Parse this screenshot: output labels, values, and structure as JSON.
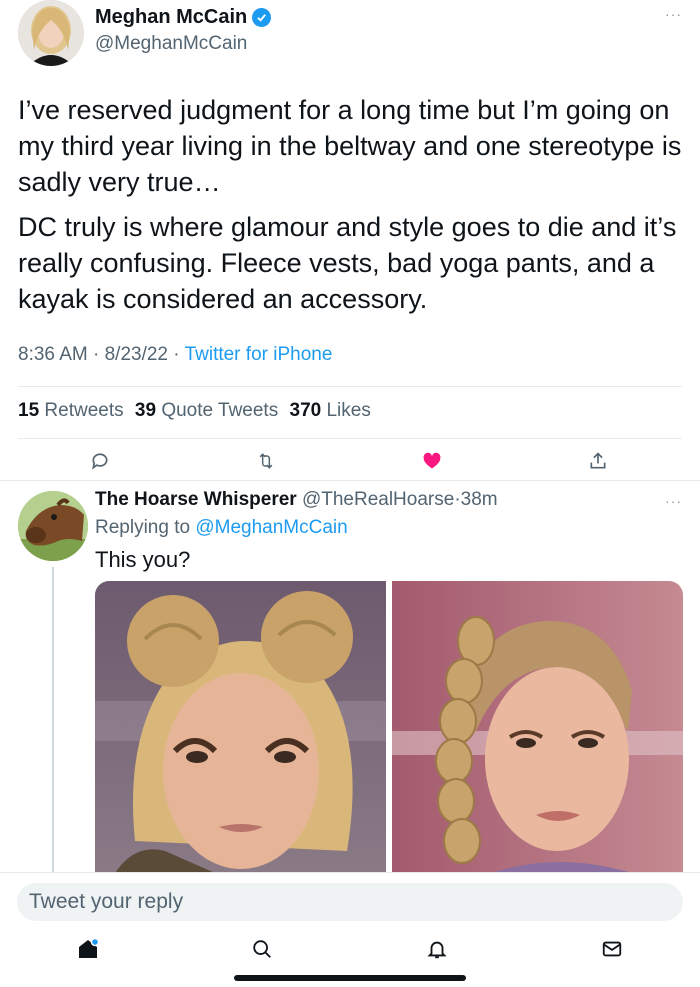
{
  "main_tweet": {
    "author": {
      "name": "Meghan McCain",
      "handle": "@MeghanMcCain",
      "verified": true
    },
    "more_icon": "more-dots-icon",
    "paragraphs": [
      "I’ve reserved judgment for a long time but I’m going on my third year living in the beltway and one stereotype is sadly very true…",
      "DC truly is where glamour and style goes to die and it’s really confusing. Fleece vests, bad yoga pants, and a kayak is considered an accessory."
    ],
    "time": "8:36 AM",
    "date": "8/23/22",
    "source": "Twitter for iPhone",
    "sep": "·",
    "stats": {
      "retweets_count": "15",
      "retweets_label": "Retweets",
      "quotes_count": "39",
      "quotes_label": "Quote Tweets",
      "likes_count": "370",
      "likes_label": "Likes"
    },
    "actions": [
      {
        "name": "reply",
        "icon": "reply-icon"
      },
      {
        "name": "retweet",
        "icon": "retweet-icon"
      },
      {
        "name": "like",
        "icon": "heart-icon",
        "active": true
      },
      {
        "name": "share",
        "icon": "share-icon"
      }
    ]
  },
  "reply_tweet": {
    "author_name": "The Hoarse Whisperer",
    "handle": "@TheRealHoarse",
    "sep": "·",
    "time_ago": "38m",
    "replying_prefix": "Replying to",
    "replying_to": "@MeghanMcCain",
    "text": "This you?"
  },
  "composer": {
    "placeholder": "Tweet your reply"
  },
  "bottom_nav": [
    {
      "name": "home",
      "icon": "home-icon",
      "active": true
    },
    {
      "name": "search",
      "icon": "search-icon"
    },
    {
      "name": "notifications",
      "icon": "bell-icon"
    },
    {
      "name": "messages",
      "icon": "mail-icon"
    }
  ],
  "colors": {
    "accent": "#1d9bf0",
    "like_active": "#f91880",
    "text_primary": "#0f1419",
    "text_secondary": "#536471"
  }
}
